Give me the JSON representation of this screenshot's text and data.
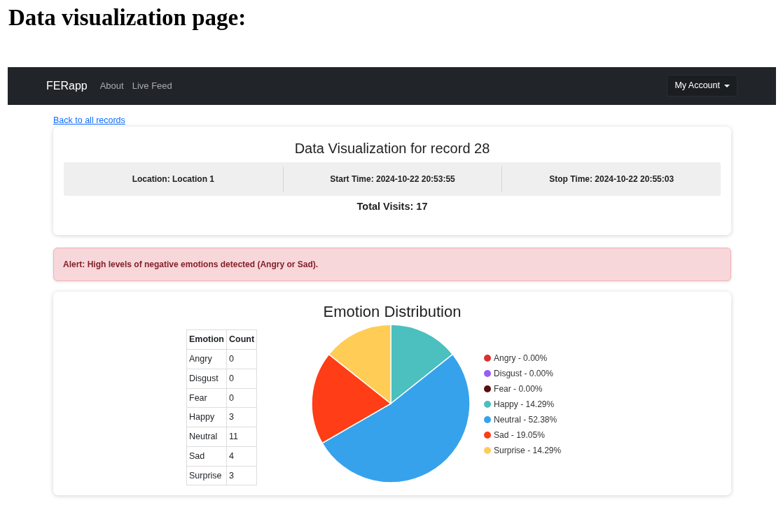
{
  "doc_heading": "Data visualization page:",
  "navbar": {
    "brand": "FERapp",
    "links": [
      "About",
      "Live Feed"
    ],
    "account_menu": "My Account"
  },
  "back_link": "Back to all records",
  "record": {
    "title": "Data Visualization for record 28",
    "info": [
      "Location: Location 1",
      "Start Time: 2024-10-22 20:53:55",
      "Stop Time: 2024-10-22 20:55:03"
    ],
    "total_visits": "Total Visits: 17"
  },
  "alert": "Alert: High levels of negative emotions detected (Angry or Sad).",
  "distribution": {
    "title": "Emotion Distribution",
    "table": {
      "columns": [
        "Emotion",
        "Count"
      ],
      "rows": [
        [
          "Angry",
          "0"
        ],
        [
          "Disgust",
          "0"
        ],
        [
          "Fear",
          "0"
        ],
        [
          "Happy",
          "3"
        ],
        [
          "Neutral",
          "11"
        ],
        [
          "Sad",
          "4"
        ],
        [
          "Surprise",
          "3"
        ]
      ]
    },
    "chart_data": {
      "type": "pie",
      "categories": [
        "Angry",
        "Disgust",
        "Fear",
        "Happy",
        "Neutral",
        "Sad",
        "Surprise"
      ],
      "values": [
        0,
        0,
        0,
        14.29,
        52.38,
        19.05,
        14.29
      ]
    },
    "legend": [
      {
        "value": "- 0.00%",
        "color": "#d8312f"
      },
      {
        "value": "- 0.00%",
        "color": "#9b5cf2"
      },
      {
        "value": "- 0.00%",
        "color": "#5a0e0e"
      },
      {
        "value": "- 14.29%",
        "color": "#4cbfbf"
      },
      {
        "value": "- 52.38%",
        "color": "#36a2eb"
      },
      {
        "value": "- 19.05%",
        "color": "#ff3d16"
      },
      {
        "value": "- 14.29%",
        "color": "#ffcd56"
      }
    ]
  }
}
